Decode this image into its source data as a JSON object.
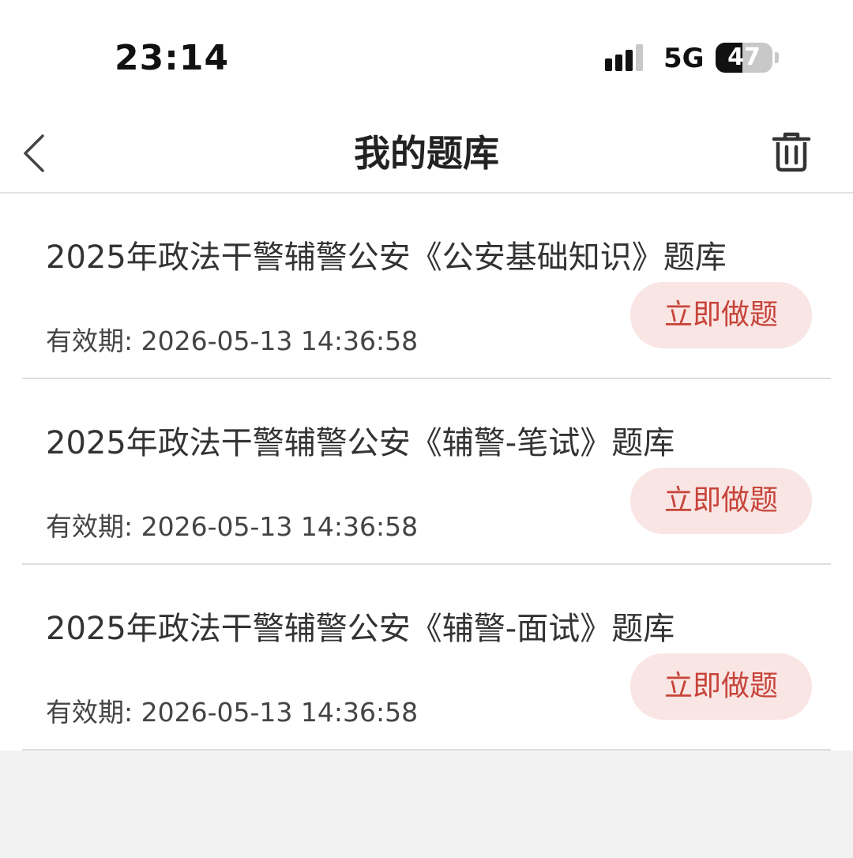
{
  "status_bar": {
    "time": "23:14",
    "network": "5G",
    "battery": "47",
    "battery_level": 0.47
  },
  "nav": {
    "title": "我的题库",
    "back_icon": "chevron-left-icon",
    "delete_icon": "trash-icon"
  },
  "items": [
    {
      "title": "2025年政法干警辅警公安《公安基础知识》题库",
      "expiry": "有效期: 2026-05-13 14:36:58",
      "action": "立即做题"
    },
    {
      "title": "2025年政法干警辅警公安《辅警-笔试》题库",
      "expiry": "有效期: 2026-05-13 14:36:58",
      "action": "立即做题"
    },
    {
      "title": "2025年政法干警辅警公安《辅警-面试》题库",
      "expiry": "有效期: 2026-05-13 14:36:58",
      "action": "立即做题"
    }
  ],
  "colors": {
    "accent": "#c7443a",
    "button_bg": "#f9e5e3",
    "background": "#f2f2f2"
  }
}
